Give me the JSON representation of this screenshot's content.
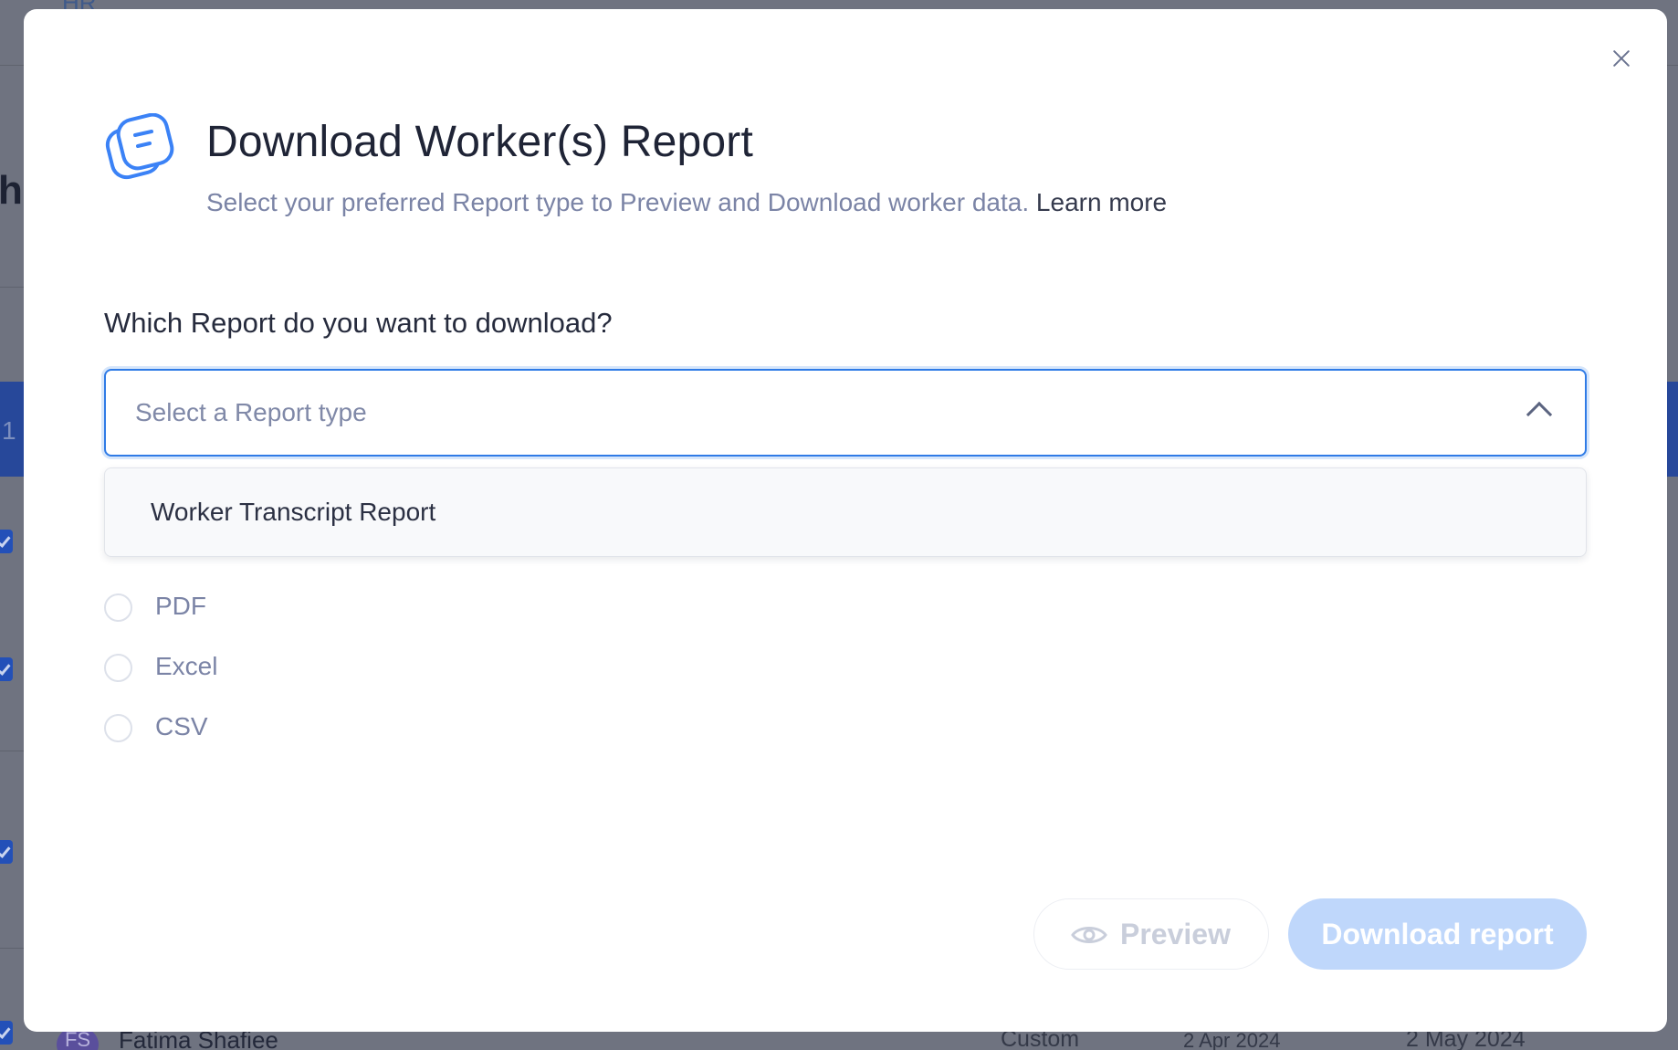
{
  "background": {
    "top_text": "HR",
    "heading_fragment": "hi",
    "row_number_fragment": "1",
    "row": {
      "avatar_initials": "FS",
      "name": "Fatima Shafiee",
      "type": "Custom",
      "start_date": "2 Apr 2024",
      "end_date": "2 May 2024"
    }
  },
  "modal": {
    "title": "Download Worker(s) Report",
    "subtitle": "Select your preferred Report type to Preview and Download worker data.",
    "learn_more": "Learn more",
    "question": "Which Report do you want to download?",
    "select": {
      "placeholder": "Select a Report type",
      "expanded": true,
      "options": [
        "Worker Transcript Report"
      ]
    },
    "formats": [
      "PDF",
      "Excel",
      "CSV"
    ],
    "buttons": {
      "preview": "Preview",
      "download": "Download report"
    },
    "icons": {
      "header": "report-chat-icon",
      "close": "close-icon",
      "chevron": "chevron-up-icon",
      "preview": "eye-icon"
    },
    "colors": {
      "accent": "#2f7be6",
      "icon_blue": "#3b82f6",
      "download_disabled": "#bfd7fb"
    }
  }
}
